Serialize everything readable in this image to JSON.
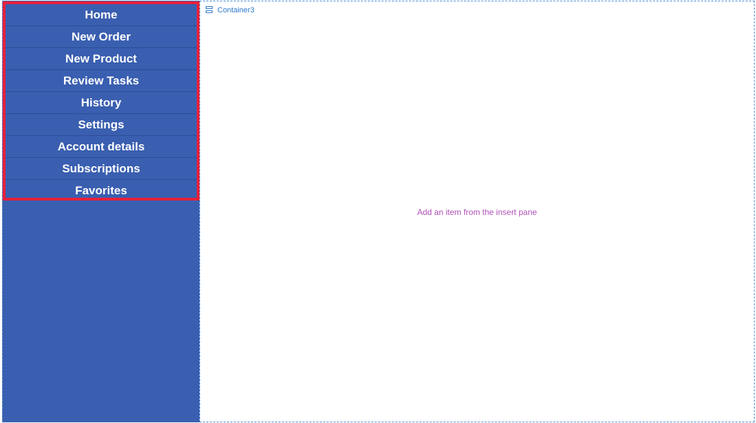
{
  "nav": {
    "items": [
      {
        "label": "Home"
      },
      {
        "label": "New Order"
      },
      {
        "label": "New Product"
      },
      {
        "label": "Review Tasks"
      },
      {
        "label": "History"
      },
      {
        "label": "Settings"
      },
      {
        "label": "Account details"
      },
      {
        "label": "Subscriptions"
      },
      {
        "label": "Favorites"
      }
    ]
  },
  "container": {
    "name": "Container3",
    "icon": "container-icon",
    "placeholder": "Add an item from the insert pane"
  },
  "colors": {
    "nav_background": "#3a5fb0",
    "selection_outline": "#e8203a",
    "container_label": "#2b79c9",
    "placeholder_text": "#b04fb8"
  }
}
